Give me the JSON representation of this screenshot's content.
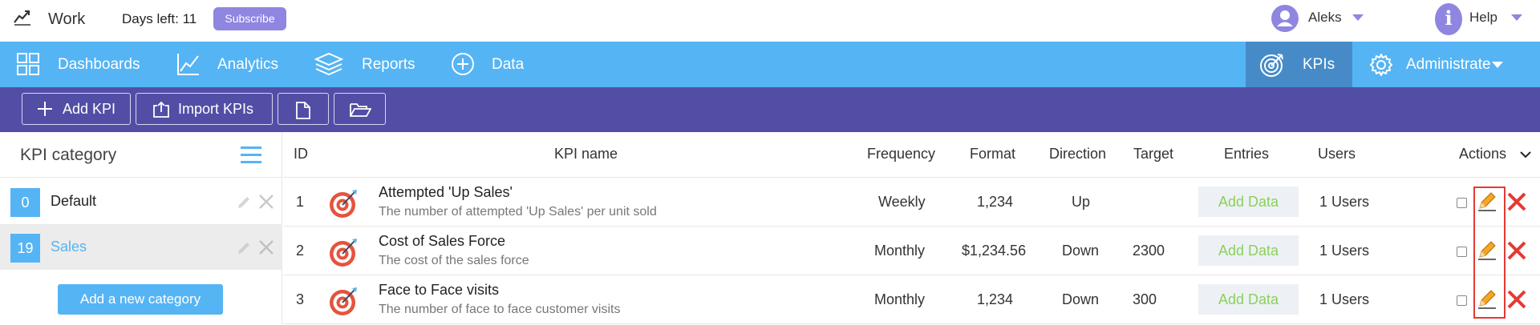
{
  "topbar": {
    "logo_icon": "trend-line-icon",
    "app_title": "Work",
    "days_left": "Days left: 11",
    "subscribe_label": "Subscribe",
    "user_name": "Aleks",
    "help_glyph": "i",
    "help_label": "Help"
  },
  "nav": {
    "items": [
      {
        "label": "Dashboards",
        "icon": "grid-icon"
      },
      {
        "label": "Analytics",
        "icon": "line-chart-icon"
      },
      {
        "label": "Reports",
        "icon": "layers-icon"
      },
      {
        "label": "Data",
        "icon": "plus-circle-icon"
      }
    ],
    "kpis_label": "KPIs",
    "admin_label": "Administrate"
  },
  "toolbar": {
    "add_kpi_label": "Add KPI",
    "import_kpis_label": "Import KPIs"
  },
  "sidebar": {
    "title": "KPI category",
    "categories": [
      {
        "count": "0",
        "label": "Default",
        "selected": false
      },
      {
        "count": "19",
        "label": "Sales",
        "selected": true
      }
    ],
    "add_category_label": "Add a new category"
  },
  "table": {
    "headers": {
      "id": "ID",
      "kpi_name": "KPI name",
      "frequency": "Frequency",
      "format": "Format",
      "direction": "Direction",
      "target": "Target",
      "entries": "Entries",
      "users": "Users",
      "actions": "Actions"
    },
    "rows": [
      {
        "id": "1",
        "name": "Attempted 'Up Sales'",
        "description": "The number of attempted 'Up Sales' per unit sold",
        "frequency": "Weekly",
        "format": "1,234",
        "direction": "Up",
        "target": "",
        "entries": "Add Data",
        "users": "1 Users"
      },
      {
        "id": "2",
        "name": "Cost of Sales Force",
        "description": "The cost of the sales force",
        "frequency": "Monthly",
        "format": "$1,234.56",
        "direction": "Down",
        "target": "2300",
        "entries": "Add Data",
        "users": "1 Users"
      },
      {
        "id": "3",
        "name": "Face to Face visits",
        "description": "The number of face to face customer visits",
        "frequency": "Monthly",
        "format": "1,234",
        "direction": "Down",
        "target": "300",
        "entries": "Add Data",
        "users": "1 Users"
      }
    ]
  },
  "colors": {
    "nav_blue": "#55b4f4",
    "nav_active": "#468bc8",
    "toolbar_purple": "#524ea6",
    "accent_purple": "#8e86e0",
    "add_data_green": "#8bd05c",
    "delete_red": "#e53935",
    "edit_orange": "#f5a623"
  }
}
